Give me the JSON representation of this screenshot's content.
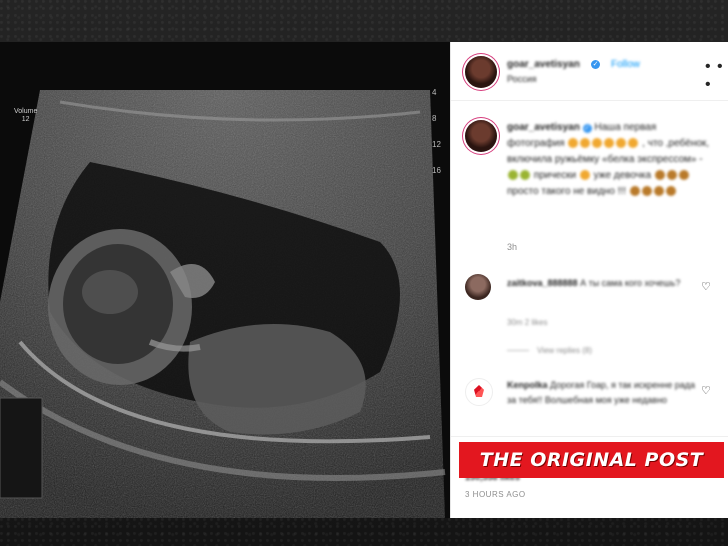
{
  "header": {
    "username": "goar_avetisyan",
    "verified_mark": "✓",
    "follow_label": "Follow",
    "location": "Россия",
    "more_label": "• • •"
  },
  "ultrasound": {
    "left_label": "Volume\n12",
    "right_marks": [
      "4",
      "8",
      "12",
      "16"
    ]
  },
  "caption": {
    "username": "goar_avetisyan",
    "text_parts": [
      "Наша первая фотография",
      ", что ,ребёнок, включила ружьёмку «белка экспрессом» -",
      "прически",
      "уже девочка",
      "просто такого не видно !!!"
    ],
    "time": "3h"
  },
  "comments": [
    {
      "username": "zaitkova_888888",
      "text": "А ты сама кого хочешь?",
      "meta": "30m   2 likes",
      "replies": "View replies (8)"
    },
    {
      "username": "Kenpolka",
      "text": "Дорогая Гоар, я так искренне рада за тебя!! Волшебная моя уже недавно"
    }
  ],
  "actions": {
    "like_icon": "♡",
    "comment_icon": "◯",
    "share_icon": "➤",
    "save_icon": "⚑"
  },
  "likes": "150,558 likes",
  "post_time": "3 HOURS AGO",
  "banner": "THE ORIGINAL POST",
  "colors": {
    "banner": "#e3171f",
    "link": "#0095f6",
    "verified": "#3897f0"
  }
}
